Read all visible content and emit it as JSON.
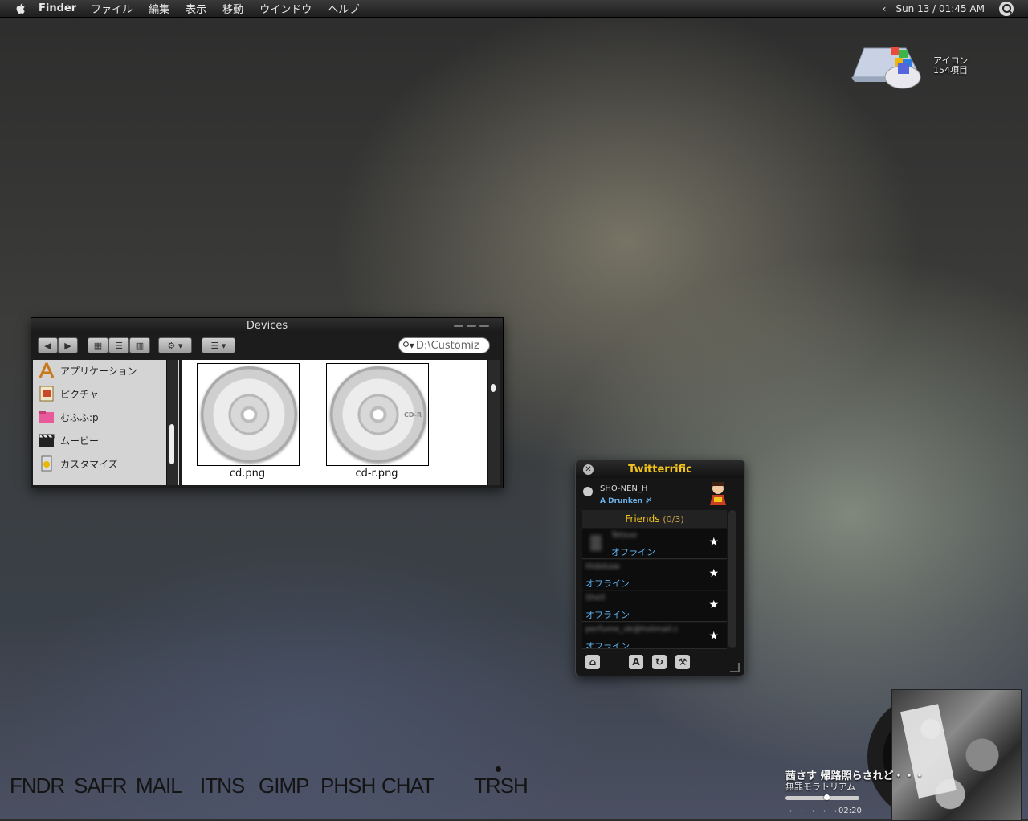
{
  "menubar": {
    "app": "Finder",
    "items": [
      "ファイル",
      "編集",
      "表示",
      "移動",
      "ウインドウ",
      "ヘルプ"
    ],
    "clock": "Sun 13 / 01:45 AM"
  },
  "desktop_icon": {
    "name": "アイコン",
    "count": "154項目"
  },
  "finder": {
    "title": "Devices",
    "search_value": "D:\\Customiz",
    "sidebar": [
      "アプリケーション",
      "ピクチャ",
      "むふふ:p",
      "ムービー",
      "カスタマイズ"
    ],
    "files": [
      {
        "name": "cd.png",
        "disc_label": ""
      },
      {
        "name": "cd-r.png",
        "disc_label": "CD-R"
      }
    ]
  },
  "twitterrific": {
    "title": "Twitterrific",
    "user": "SHO-NEN_H",
    "status": "A Drunken 〆",
    "group": "Friends",
    "group_count": "(0/3)",
    "friends": [
      {
        "name": "Tetsuo",
        "status": "オフライン"
      },
      {
        "name": "Hidekaw",
        "status": "オフライン"
      },
      {
        "name": "Shell",
        "status": "オフライン"
      },
      {
        "name": "perfume_ok@hotmail.c",
        "status": "オフライン"
      }
    ]
  },
  "dock": [
    "FNDR",
    "SAFR",
    "MAIL",
    "ITNS",
    "GIMP",
    "PHSH",
    "CHAT",
    "TRSH"
  ],
  "music": {
    "title": "茜さす 帰路照らされど・・・",
    "album": "無罪モラトリアム",
    "time": "02:20",
    "dots": "・・・・・",
    "progress": 0.55
  },
  "colors": {
    "accent": "#f0c419",
    "link": "#5fb2f0"
  }
}
